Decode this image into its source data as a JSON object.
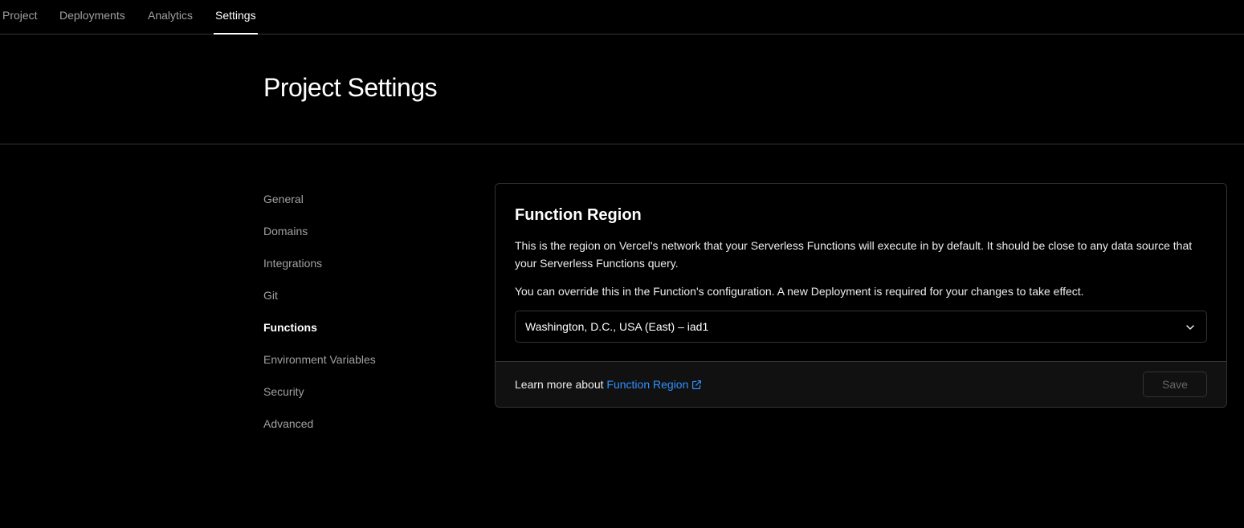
{
  "topnav": {
    "tabs": [
      {
        "label": "Project"
      },
      {
        "label": "Deployments"
      },
      {
        "label": "Analytics"
      },
      {
        "label": "Settings"
      }
    ],
    "active": "Settings"
  },
  "header": {
    "title": "Project Settings"
  },
  "sidebar": {
    "items": [
      {
        "label": "General"
      },
      {
        "label": "Domains"
      },
      {
        "label": "Integrations"
      },
      {
        "label": "Git"
      },
      {
        "label": "Functions"
      },
      {
        "label": "Environment Variables"
      },
      {
        "label": "Security"
      },
      {
        "label": "Advanced"
      }
    ],
    "active": "Functions"
  },
  "card": {
    "title": "Function Region",
    "description": "This is the region on Vercel's network that your Serverless Functions will execute in by default. It should be close to any data source that your Serverless Functions query.",
    "note": "You can override this in the Function's configuration. A new Deployment is required for your changes to take effect.",
    "region_select": {
      "value": "Washington, D.C., USA (East) – iad1",
      "icon": "chevron-down-icon"
    },
    "footer": {
      "learn_prefix": "Learn more about",
      "learn_link": "Function Region",
      "learn_icon": "external-link-icon",
      "save_label": "Save"
    }
  },
  "colors": {
    "background": "#000000",
    "border": "#333333",
    "link": "#3291ff",
    "muted_text": "#a1a1a1",
    "footer_bg": "#111111"
  }
}
